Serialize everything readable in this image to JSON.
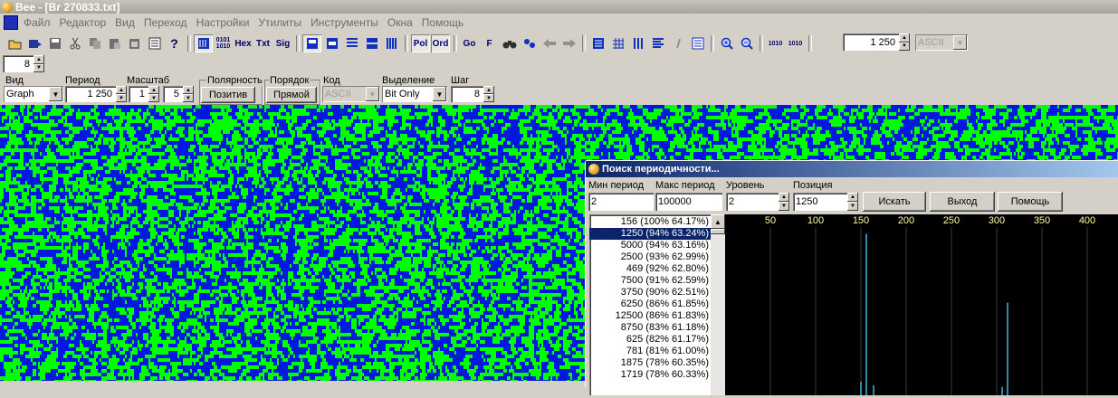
{
  "window": {
    "title": "Bee - [Br 270833.txt]"
  },
  "menu": [
    "Файл",
    "Редактор",
    "Вид",
    "Переход",
    "Настройки",
    "Утилиты",
    "Инструменты",
    "Окна",
    "Помощь"
  ],
  "toolbar": {
    "text_buttons": {
      "bin": "0101\n1010",
      "hex": "Hex",
      "txt": "Txt",
      "sig": "Sig",
      "pol": "Pol",
      "ord": "Ord",
      "go": "Go",
      "f": "F",
      "bits_a": "1010",
      "bits_b": "1010"
    },
    "period_value": "1 250",
    "encoding": "ASCII",
    "step_value": "8"
  },
  "params": {
    "view_label": "Вид",
    "view_value": "Graph",
    "period_label": "Период",
    "period_value": "1 250",
    "scale_label": "Масштаб",
    "scale_x": "1",
    "scale_y": "5",
    "polarity_label": "Полярность",
    "polarity_button": "Позитив",
    "order_label": "Порядок",
    "order_button": "Прямой",
    "code_label": "Код",
    "code_value": "ASCII",
    "selection_label": "Выделение",
    "selection_value": "Bit Only",
    "step_label": "Шаг",
    "step_value": "8"
  },
  "colors": {
    "bit_one": "#00ff00",
    "bit_zero": "#0018e0",
    "plot_bg": "#000000",
    "plot_line": "#3fb7d9",
    "plot_tick_label": "#ffff9c"
  },
  "dialog": {
    "title": "Поиск периодичности...",
    "min_period_label": "Мин период",
    "min_period_value": "2",
    "max_period_label": "Макс период",
    "max_period_value": "100000",
    "level_label": "Уровень",
    "level_value": "2",
    "position_label": "Позиция",
    "position_value": "1250",
    "search_button": "Искать",
    "exit_button": "Выход",
    "help_button": "Помощь",
    "results": [
      "156 (100% 64.17%)",
      "1250 (94% 63.24%)",
      "5000 (94% 63.16%)",
      "2500 (93% 62.99%)",
      "469 (92% 62.80%)",
      "7500 (91% 62.59%)",
      "3750 (90% 62.51%)",
      "6250 (86% 61.85%)",
      "12500 (86% 61.83%)",
      "8750 (83% 61.18%)",
      "625 (82% 61.17%)",
      "781 (81% 61.00%)",
      "1875 (78% 60.35%)",
      "1719 (78% 60.33%)"
    ],
    "selected_index": 1,
    "plot": {
      "x_ticks": [
        "50",
        "100",
        "150",
        "200",
        "250",
        "300",
        "350",
        "400"
      ],
      "peaks": [
        {
          "x": 156,
          "level": 0.96
        },
        {
          "x": 312,
          "level": 0.55
        },
        {
          "x": 150,
          "level": 0.08
        },
        {
          "x": 164,
          "level": 0.06
        },
        {
          "x": 306,
          "level": 0.05
        }
      ]
    }
  }
}
